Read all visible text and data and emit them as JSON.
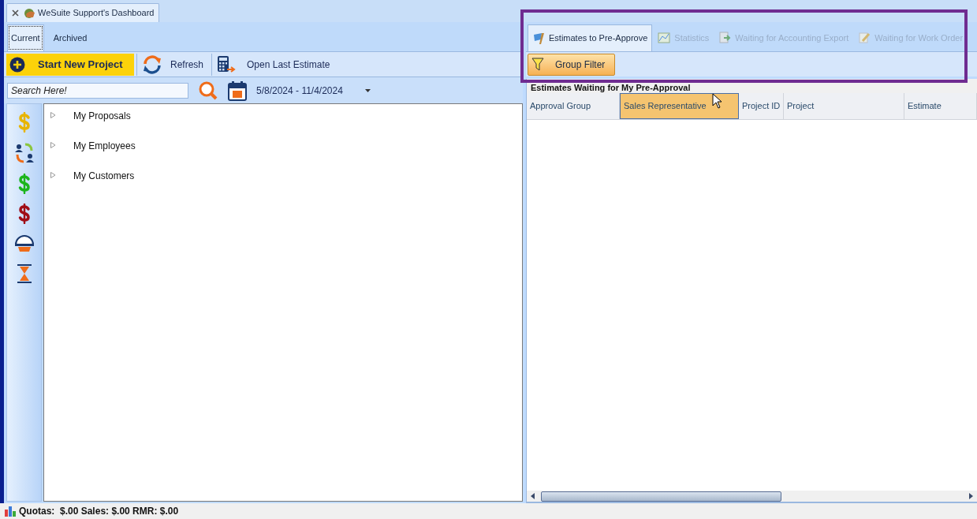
{
  "document_tab": {
    "title": "WeSuite Support's Dashboard"
  },
  "view_tabs": [
    {
      "label": "Current",
      "selected": true
    },
    {
      "label": "Archived",
      "selected": false
    }
  ],
  "toolbar": [
    {
      "kind": "primary",
      "label": "Start New Project"
    },
    {
      "kind": "refresh",
      "label": "Refresh"
    },
    {
      "kind": "estimate",
      "label": "Open Last Estimate"
    }
  ],
  "search": {
    "placeholder": "Search Here!"
  },
  "date_range": "5/8/2024 - 11/4/2024",
  "side_icons": [
    {
      "kind": "dollar",
      "color": "#e8b400"
    },
    {
      "kind": "people"
    },
    {
      "kind": "dollar",
      "color": "#1cb51c"
    },
    {
      "kind": "dollar",
      "color": "#a00d16"
    },
    {
      "kind": "helmet"
    },
    {
      "kind": "hourglass"
    }
  ],
  "tree": [
    {
      "label": "My Proposals",
      "expanded": false
    },
    {
      "label": "My Employees",
      "expanded": false
    },
    {
      "label": "My Customers",
      "expanded": false
    }
  ],
  "right_tabs": [
    {
      "kind": "flag",
      "label": "Estimates to Pre-Approve",
      "selected": true,
      "disabled": false
    },
    {
      "kind": "chart",
      "label": "Statistics",
      "selected": false,
      "disabled": true
    },
    {
      "kind": "export",
      "label": "Waiting for Accounting Export",
      "selected": false,
      "disabled": true
    },
    {
      "kind": "pencil",
      "label": "Waiting for Work Order",
      "selected": false,
      "disabled": true
    }
  ],
  "group_filter": "Group Filter",
  "grid": {
    "title": "Estimates Waiting for My Pre-Approval",
    "columns": [
      {
        "label": "Approval Group",
        "selected": false
      },
      {
        "label": "Sales Representative",
        "selected": true
      },
      {
        "label": "Project ID",
        "selected": false
      },
      {
        "label": "Project",
        "selected": false
      },
      {
        "label": "Estimate",
        "selected": false
      }
    ]
  },
  "status_bar": "Quotas:  $.00 Sales: $.00 RMR: $.00"
}
